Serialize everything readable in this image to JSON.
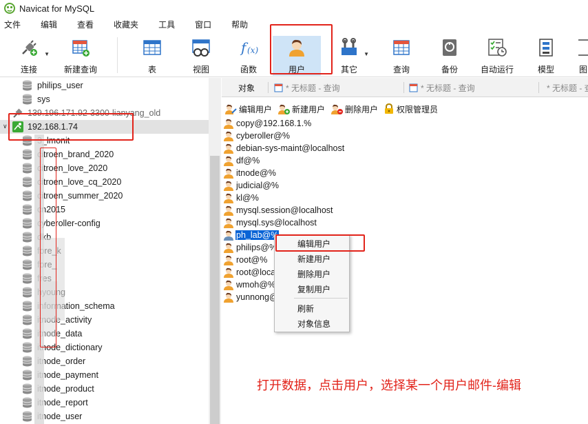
{
  "window": {
    "title": "Navicat for MySQL"
  },
  "menu": [
    "文件",
    "编辑",
    "查看",
    "收藏夹",
    "工具",
    "窗口",
    "帮助"
  ],
  "toolbar": {
    "connect": "连接",
    "new_query": "新建查询",
    "table": "表",
    "view": "视图",
    "function": "函数",
    "user": "用户",
    "other": "其它",
    "query": "查询",
    "backup": "备份",
    "automation": "自动运行",
    "model": "模型",
    "chart_partial": "图"
  },
  "tree": {
    "top_items": [
      "philips_user",
      "sys"
    ],
    "other_connection": "139.196.171.92-3300-lianyang_old",
    "active_connection": "192.168.1.74",
    "databases": [
      "3_lmonit",
      "citroen_brand_2020",
      "citroen_love_2020",
      "citroen_love_cq_2020",
      "citroen_summer_2020",
      "cn2015",
      "cyberoller-config",
      "dkb",
      "fore_k",
      "fore_",
      "fres",
      "hyoung",
      "information_schema",
      "itnode_activity",
      "itnode_data",
      "itnode_dictionary",
      "itnode_order",
      "itnode_payment",
      "itnode_product",
      "itnode_report",
      "itnode_user"
    ]
  },
  "tabs": {
    "object": "对象",
    "untitled_query": "* 无标题 - 查询"
  },
  "subtoolbar": {
    "edit_user": "编辑用户",
    "new_user": "新建用户",
    "delete_user": "删除用户",
    "privilege_manager": "权限管理员"
  },
  "users": [
    "copy@192.168.1.%",
    "cyberoller@%",
    "debian-sys-maint@localhost",
    "df@%",
    "itnode@%",
    "judicial@%",
    "kl@%",
    "mysql.session@localhost",
    "mysql.sys@localhost",
    "ph_lab@%",
    "philips@%",
    "root@%",
    "root@loca",
    "wmoh@%",
    "yunnong@"
  ],
  "selected_user": "ph_lab@%",
  "context_menu": {
    "edit_user": "编辑用户",
    "new_user": "新建用户",
    "delete_user": "删除用户",
    "copy_user": "复制用户",
    "refresh": "刷新",
    "object_info": "对象信息"
  },
  "annotation": "打开数据，点击用户，选择某一个用户邮件-编辑",
  "colors": {
    "accent_red": "#e2231a",
    "selection_blue": "#0a64d6",
    "active_tool": "#cfe4f7"
  }
}
